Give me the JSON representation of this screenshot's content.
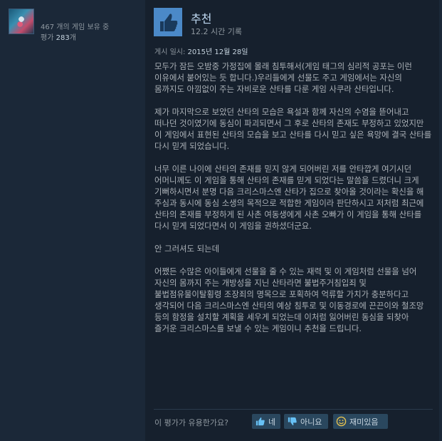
{
  "profile": {
    "games_owned": "467",
    "games_owned_suffix": "개의 게임 보유 중",
    "reviews_prefix": "평가",
    "reviews_count": "283",
    "reviews_suffix": "개"
  },
  "review": {
    "title": "추천",
    "hours": "12.2 시간 기록",
    "posted_label": "게시 일시:",
    "posted_date": "2015년 12월 28일",
    "paragraphs": [
      "모두가 잠든 오밤중 가정집에 몰래 침투해서(게임 태그의 심리적 공포는 이런 이유에서 붙어있는 듯 합니다.)우리들에게 선물도 주고 게임에서는 자신의 몸까지도 아낌없이 주는 자비로운 산타를 다룬 게임 사쿠라 산타입니다.",
      "제가 마지막으로 보았던 산타의 모습은 욕설과 함께 자신의 수염을 뜯어내고 떠나던 것이였기에 동심이 파괴되면서 그 후로 산타의 존재도 부정하고 있었지만 이 게임에서 표현된 산타의 모습을 보고 산타를 다시 믿고 싶은 욕망에 결국 산타를 다시 믿게 되었습니다.",
      "너무 이른 나이에 산타의 존재를 믿지 않게 되어버린 저를 안타깝게 여기시던 어머니께도 이 게임을 통해 산타의 존재를 믿게 되었다는 말씀을 드렸더니 크게 기뻐하시면서 분명 다음 크리스마스엔 산타가 집으로 찾아올 것이라는 확신을 해 주심과 동시에 동심 소생의 목적으로 적합한 게임이라 판단하시고 저처럼 최근에 산타의 존재를 부정하게 된 사촌 여동생에게 사촌 오빠가 이 게임을 통해 산타를 다시 믿게 되었다면서 이 게임을 권하셨더군요.",
      "안 그러셔도 되는데",
      "어쨌든 수많은 아이들에게 선물을 줄 수 있는 재력 및 이 게임처럼 선물을 넘어 자신의 몸까지 주는 개방성을 지닌 산타라면 불법주거침입죄 및 불법점유물이탈횡령 조장죄의 명목으로 포획하여 억류할 가치가 충분하다고 생각되어 다음 크리스마스엔 산타의 예상 침투로 및 이동경로에 끈끈이와 철조망 등의 함정을 설치할 계획을 세우게 되었는데 이처럼 잃어버린 동심을 되찾아 즐거운 크리스마스를 보낼 수 있는 게임이니 추천을 드립니다."
    ],
    "helpful_question": "이 평가가 유용한가요?",
    "buttons": {
      "yes": "네",
      "no": "아니요",
      "funny": "재미있음"
    }
  },
  "icons": {
    "review_thumb": "thumbs-up-icon",
    "yes_icon": "thumbs-up-icon",
    "no_icon": "thumbs-down-icon",
    "funny_icon": "smiley-icon"
  },
  "colors": {
    "page_bg": "#1b2838",
    "review_bg": "#16202d",
    "thumb_bg": "#4b89c8",
    "title": "#c1dbf4",
    "button_bg": "#2a475e"
  }
}
